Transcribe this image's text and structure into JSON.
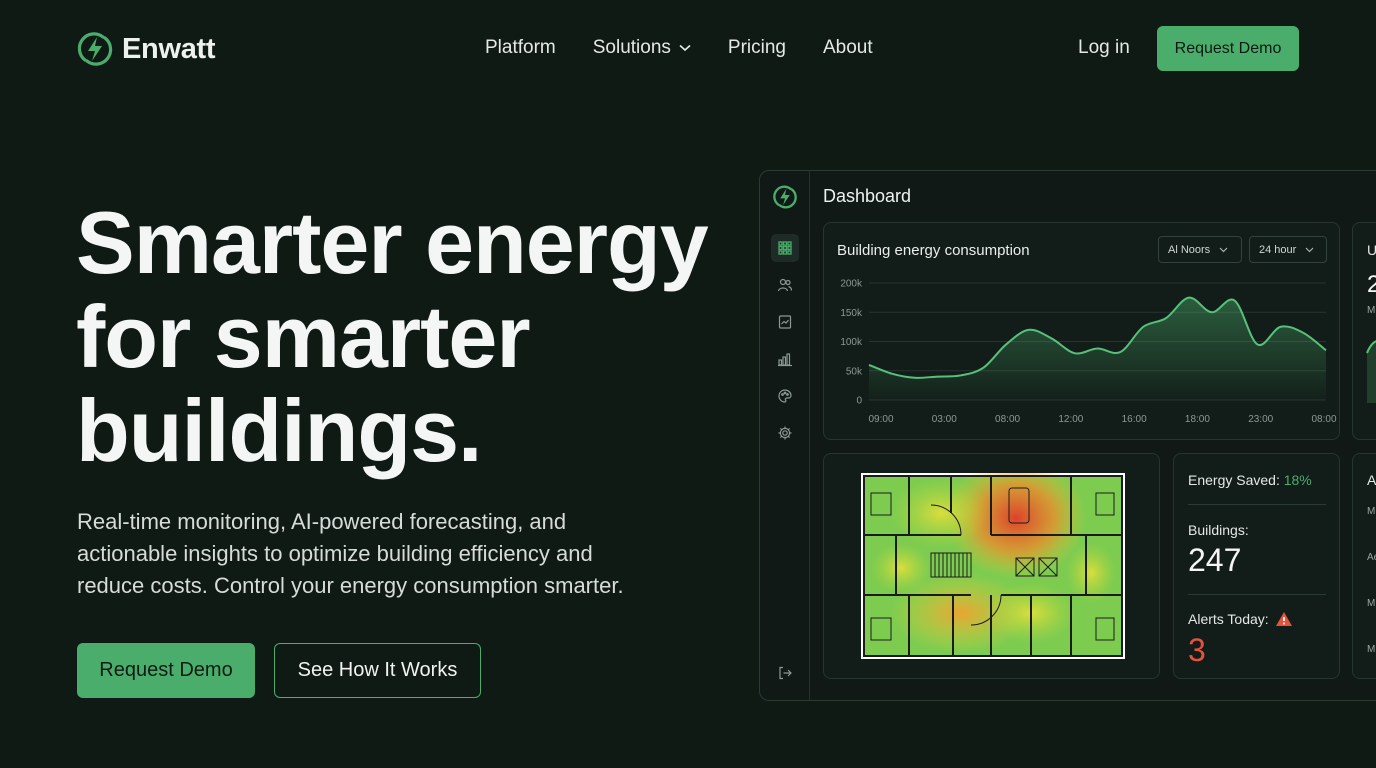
{
  "nav": {
    "brand": "Enwatt",
    "links": [
      "Platform",
      "Solutions",
      "Pricing",
      "About"
    ],
    "login": "Log in",
    "cta": "Request Demo"
  },
  "hero": {
    "title_lines": [
      "Smarter energy",
      "for smarter",
      "buildings."
    ],
    "subtitle_lines": [
      "Real-time monitoring, AI-powered forecasting, and",
      "actionable insights to optimize building efficiency and",
      "reduce costs. Control your energy consumption smarter."
    ],
    "primary_cta": "Request Demo",
    "secondary_cta": "See How It Works"
  },
  "dashboard": {
    "title": "Dashboard",
    "sidebar_icons": [
      "grid-icon",
      "users-icon",
      "document-chart-icon",
      "bar-chart-icon",
      "palette-icon",
      "gear-icon",
      "logout-icon"
    ],
    "chart_card": {
      "title": "Building energy consumption",
      "filter_building": "Al Noors",
      "filter_range": "24 hour"
    },
    "stats": {
      "energy_saved_label": "Energy Saved:",
      "energy_saved_value": "18%",
      "buildings_label": "Buildings:",
      "buildings_value": "247",
      "alerts_label": "Alerts Today:",
      "alerts_value": "3"
    },
    "edge_card_letters": [
      "U",
      "2",
      "M",
      "A",
      "M",
      "Ae",
      "M",
      "M"
    ]
  },
  "colors": {
    "background": "#0f1a15",
    "accent": "#4bad6c",
    "alert": "#e5533d"
  },
  "chart_data": {
    "type": "area",
    "x": [
      "09:00",
      "03:00",
      "08:00",
      "12:00",
      "16:00",
      "18:00",
      "23:00",
      "08:00"
    ],
    "y": [
      60,
      45,
      38,
      40,
      42,
      55,
      95,
      120,
      105,
      80,
      88,
      82,
      125,
      140,
      175,
      150,
      170,
      95,
      125,
      115,
      85
    ],
    "y_ticks": [
      "0",
      "50k",
      "100k",
      "150k",
      "200k"
    ],
    "ylim": [
      0,
      200000
    ],
    "grid": true
  }
}
